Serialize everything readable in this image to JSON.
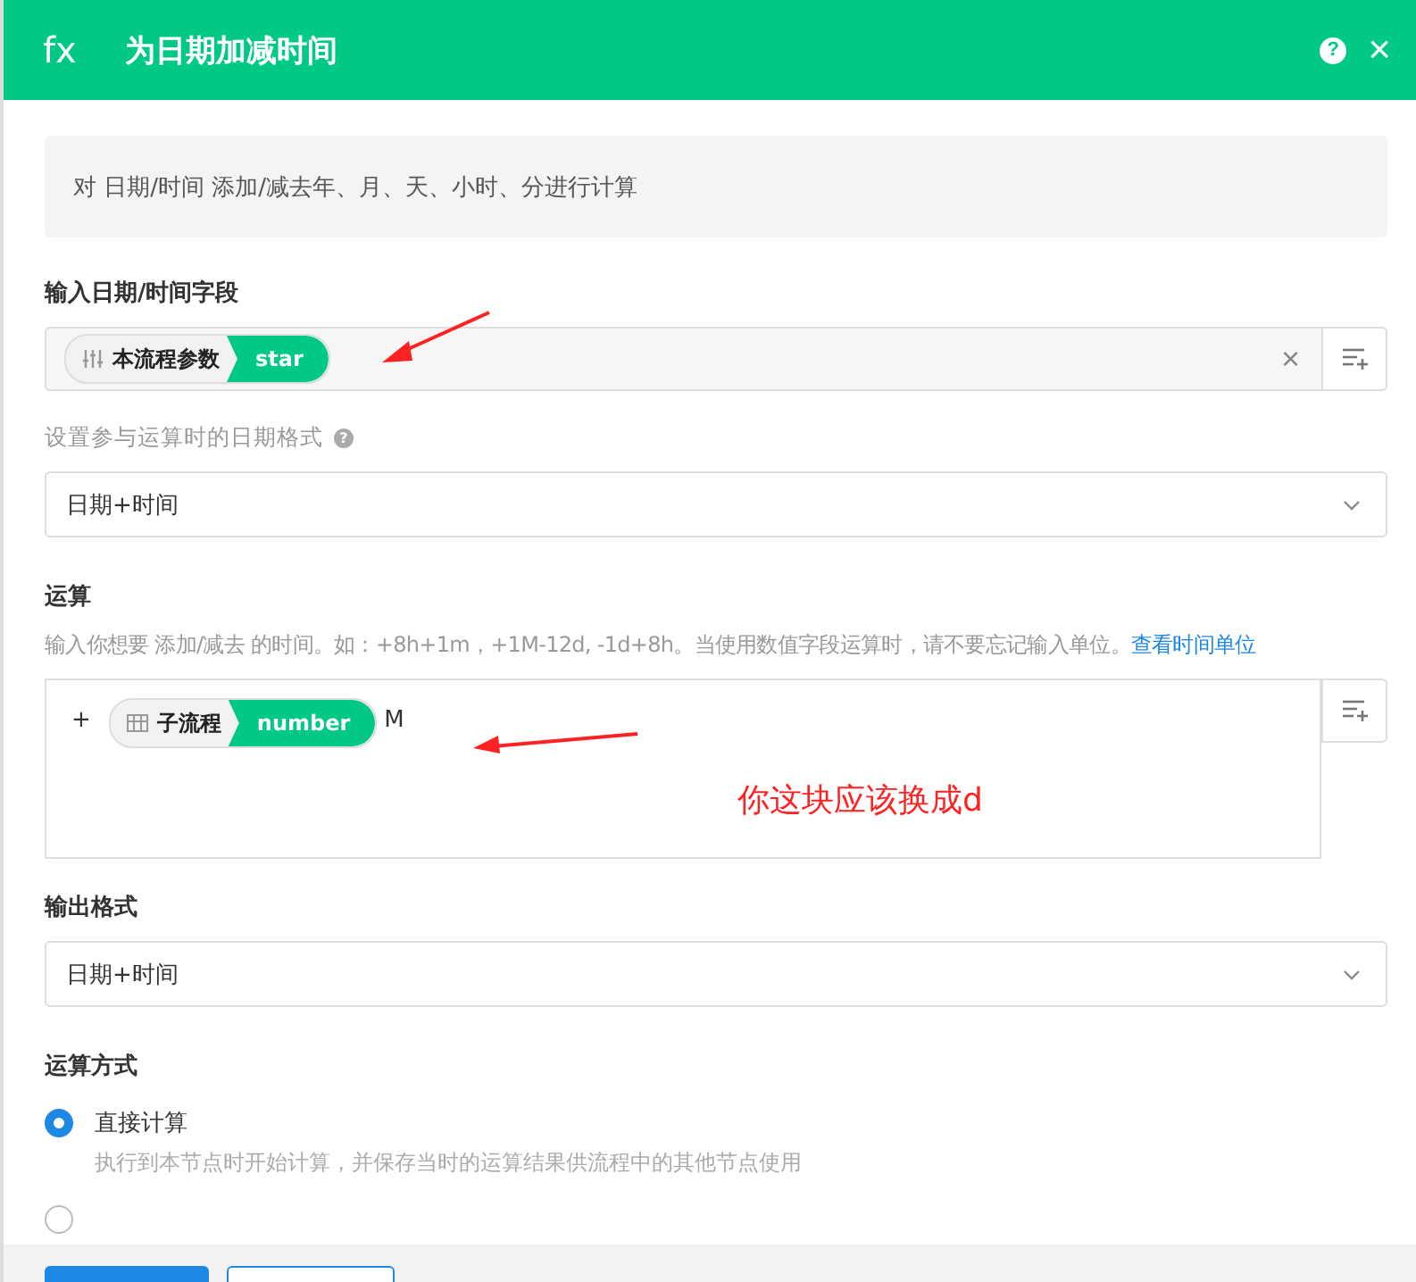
{
  "window": {
    "icon_text": "fx",
    "title": "为日期加减时间",
    "help": "?",
    "close": "×"
  },
  "description": "对 日期/时间 添加/减去年、月、天、小时、分进行计算",
  "input_field": {
    "label": "输入日期/时间字段",
    "tag": {
      "group": "本流程参数",
      "name": "star"
    },
    "clear": "×"
  },
  "date_format": {
    "label": "设置参与运算时的日期格式",
    "help": "?",
    "value": "日期+时间"
  },
  "operation": {
    "label": "运算",
    "hint": "输入你想要 添加/减去 的时间。如：+8h+1m，+1M-12d, -1d+8h。当使用数值字段运算时，请不要忘记输入单位。",
    "hint_link": "查看时间单位",
    "sign": "+",
    "tag": {
      "group": "子流程",
      "name": "number"
    },
    "unit": "M"
  },
  "annotation": {
    "text": "你这块应该换成d"
  },
  "output_format": {
    "label": "输出格式",
    "value": "日期+时间"
  },
  "mode": {
    "label": "运算方式",
    "options": [
      {
        "label": "直接计算",
        "description": "执行到本节点时开始计算，并保存当时的运算结果供流程中的其他节点使用",
        "selected": true
      },
      {
        "selected": false
      }
    ]
  }
}
